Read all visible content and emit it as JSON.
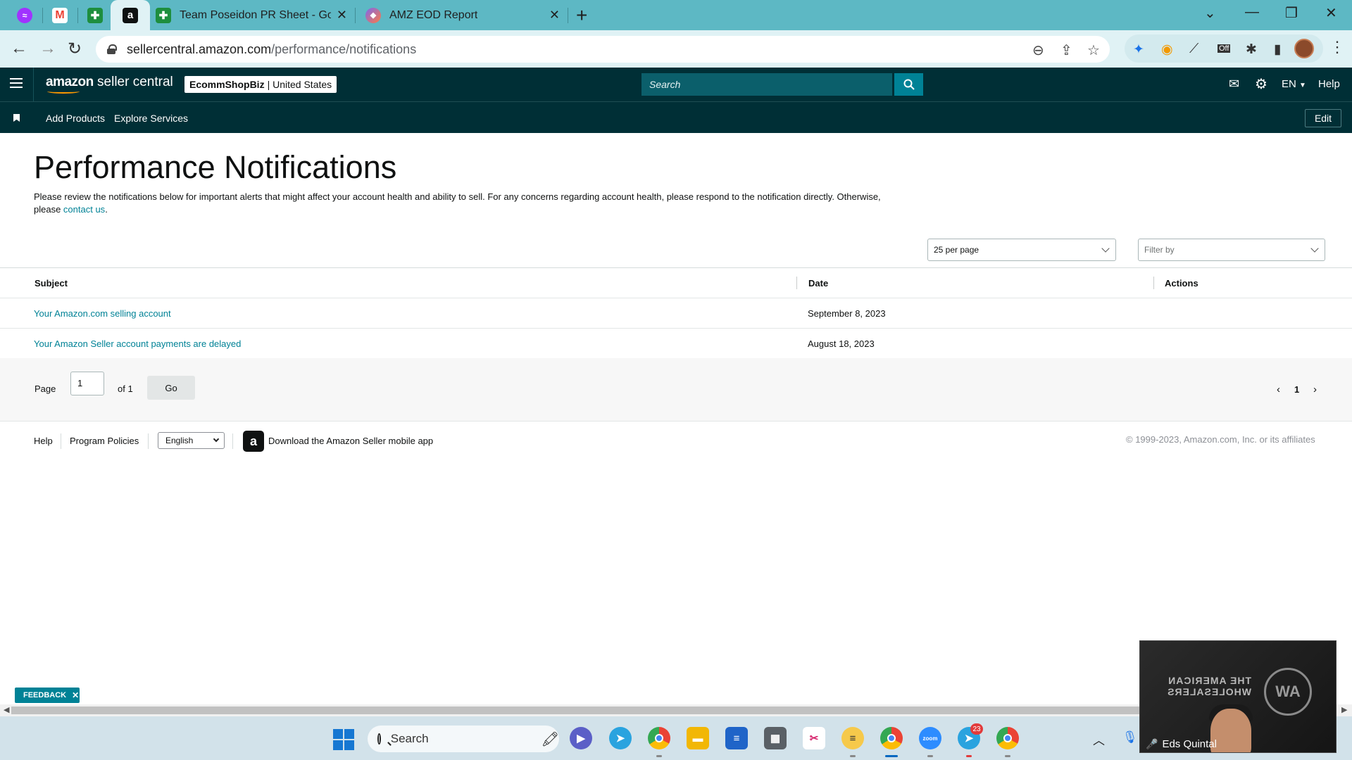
{
  "browser": {
    "tabs": [
      {
        "title": "",
        "icon": "messenger-icon",
        "color": "#a033ff"
      },
      {
        "title": "",
        "icon": "gmail-icon",
        "color": "#ea4335"
      },
      {
        "title": "",
        "icon": "google-sheets-icon",
        "color": "#1e8e3e"
      },
      {
        "title": "",
        "icon": "amazon-icon",
        "color": "#0f1111"
      },
      {
        "title": "Team Poseidon PR Sheet - Goog",
        "icon": "google-sheets-icon",
        "color": "#1e8e3e"
      },
      {
        "title": "AMZ EOD Report",
        "icon": "clickup-icon",
        "color": "#7b68ee"
      }
    ],
    "url_host": "sellercentral.amazon.com",
    "url_path": "/performance/notifications",
    "extension_badge": "Off"
  },
  "header": {
    "logo_brand": "amazon",
    "logo_product": "seller central",
    "store_name": "EcommShopBiz",
    "store_region": "United States",
    "search_placeholder": "Search",
    "language": "EN",
    "help": "Help"
  },
  "subnav": {
    "links": [
      "Add Products",
      "Explore Services"
    ],
    "edit": "Edit"
  },
  "page": {
    "title": "Performance Notifications",
    "intro_text": "Please review the notifications below for important alerts that might affect your account health and ability to sell. For any concerns regarding account health, please respond to the notification directly. Otherwise, please ",
    "intro_link": "contact us",
    "intro_end": ".",
    "per_page": "25 per page",
    "filter_placeholder": "Filter by"
  },
  "table": {
    "columns": [
      "Subject",
      "Date",
      "Actions"
    ],
    "rows": [
      {
        "subject": "Your Amazon.com selling account",
        "date": "September 8, 2023",
        "actions": ""
      },
      {
        "subject": "Your Amazon Seller account payments are delayed",
        "date": "August 18, 2023",
        "actions": ""
      }
    ]
  },
  "pagination": {
    "page_label": "Page",
    "current_page": "1",
    "of_label": "of 1",
    "go_label": "Go",
    "page_number": "1"
  },
  "footer": {
    "help": "Help",
    "policies": "Program Policies",
    "language": "English",
    "app_text": "Download the Amazon Seller mobile app",
    "copyright": "© 1999-2023, Amazon.com, Inc. or its affiliates"
  },
  "feedback": "FEEDBACK",
  "taskbar": {
    "search_label": "Search",
    "telegram_badge": "23"
  },
  "video": {
    "participant": "Eds Quintal",
    "brand_text": "THE AMERICAN WHOLESALERS",
    "emblem": "AW"
  },
  "colors": {
    "header_bg": "#002f36",
    "link": "#008296",
    "tab_strip": "#5db8c4"
  }
}
